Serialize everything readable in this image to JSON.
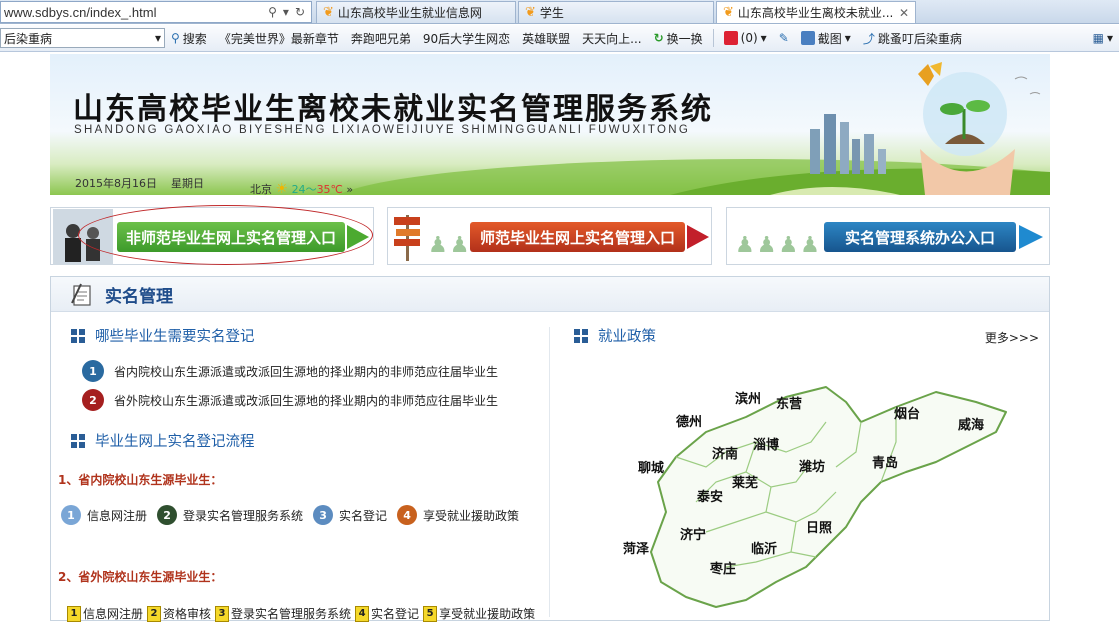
{
  "browser": {
    "address": "www.sdbys.cn/index_.html",
    "tabs": [
      {
        "label": "山东高校毕业生就业信息网"
      },
      {
        "label": "学生"
      },
      {
        "label": "山东高校毕业生离校未就业..."
      }
    ],
    "toolbar": {
      "search_value": "后染重病",
      "search_btn": "搜索",
      "links": [
        "《完美世界》最新章节",
        "奔跑吧兄弟",
        "90后大学生网恋",
        "英雄联盟",
        "天天向上..."
      ],
      "refresh": "换一换",
      "count": "(0)",
      "screenshot": "截图",
      "news": "跳蚤叮后染重病"
    }
  },
  "banner": {
    "title": "山东高校毕业生离校未就业实名管理服务系统",
    "subtitle": "SHANDONG GAOXIAO BIYESHENG LIXIAOWEIJIUYE SHIMINGGUANLI FUWUXITONG",
    "date": "2015年8月16日",
    "weekday": "星期日",
    "city": "北京",
    "temp_low": "24",
    "sep": "～",
    "temp_high": "35℃"
  },
  "entries": [
    {
      "label": "非师范毕业生网上实名管理入口",
      "color": "#3c9a2a"
    },
    {
      "label": "师范毕业生网上实名管理入口",
      "color": "#c23a1c"
    },
    {
      "label": "实名管理系统办公入口",
      "color": "#1f6aa8"
    }
  ],
  "panel": {
    "title": "实名管理",
    "left": {
      "who_title": "哪些毕业生需要实名登记",
      "who_items": [
        {
          "num": "1",
          "text": "省内院校山东生源派遣或改派回生源地的择业期内的非师范应往届毕业生",
          "color": "#2a6aa0"
        },
        {
          "num": "2",
          "text": "省外院校山东生源派遣或改派回生源地的择业期内的非师范应往届毕业生",
          "color": "#a51f1f"
        }
      ],
      "flow_title": "毕业生网上实名登记流程",
      "group1_title": "1、省内院校山东生源毕业生：",
      "group1_steps": [
        {
          "num": "1",
          "label": "信息网注册",
          "color": "#7aa6d6"
        },
        {
          "num": "2",
          "label": "登录实名管理服务系统",
          "color": "#2f4f2f"
        },
        {
          "num": "3",
          "label": "实名登记",
          "color": "#5c8cc0"
        },
        {
          "num": "4",
          "label": "享受就业援助政策",
          "color": "#c8611e"
        }
      ],
      "group2_title": "2、省外院校山东生源毕业生：",
      "group2_steps": [
        {
          "num": "1",
          "label": "信息网注册"
        },
        {
          "num": "2",
          "label": "资格审核"
        },
        {
          "num": "3",
          "label": "登录实名管理服务系统"
        },
        {
          "num": "4",
          "label": "实名登记"
        },
        {
          "num": "5",
          "label": "享受就业援助政策"
        }
      ]
    },
    "right": {
      "title": "就业政策",
      "more": "更多>>>",
      "cities": [
        "滨州",
        "东营",
        "烟台",
        "威海",
        "德州",
        "济南",
        "淄博",
        "潍坊",
        "青岛",
        "聊城",
        "莱芜",
        "泰安",
        "济宁",
        "临沂",
        "日照",
        "菏泽",
        "枣庄"
      ]
    }
  }
}
